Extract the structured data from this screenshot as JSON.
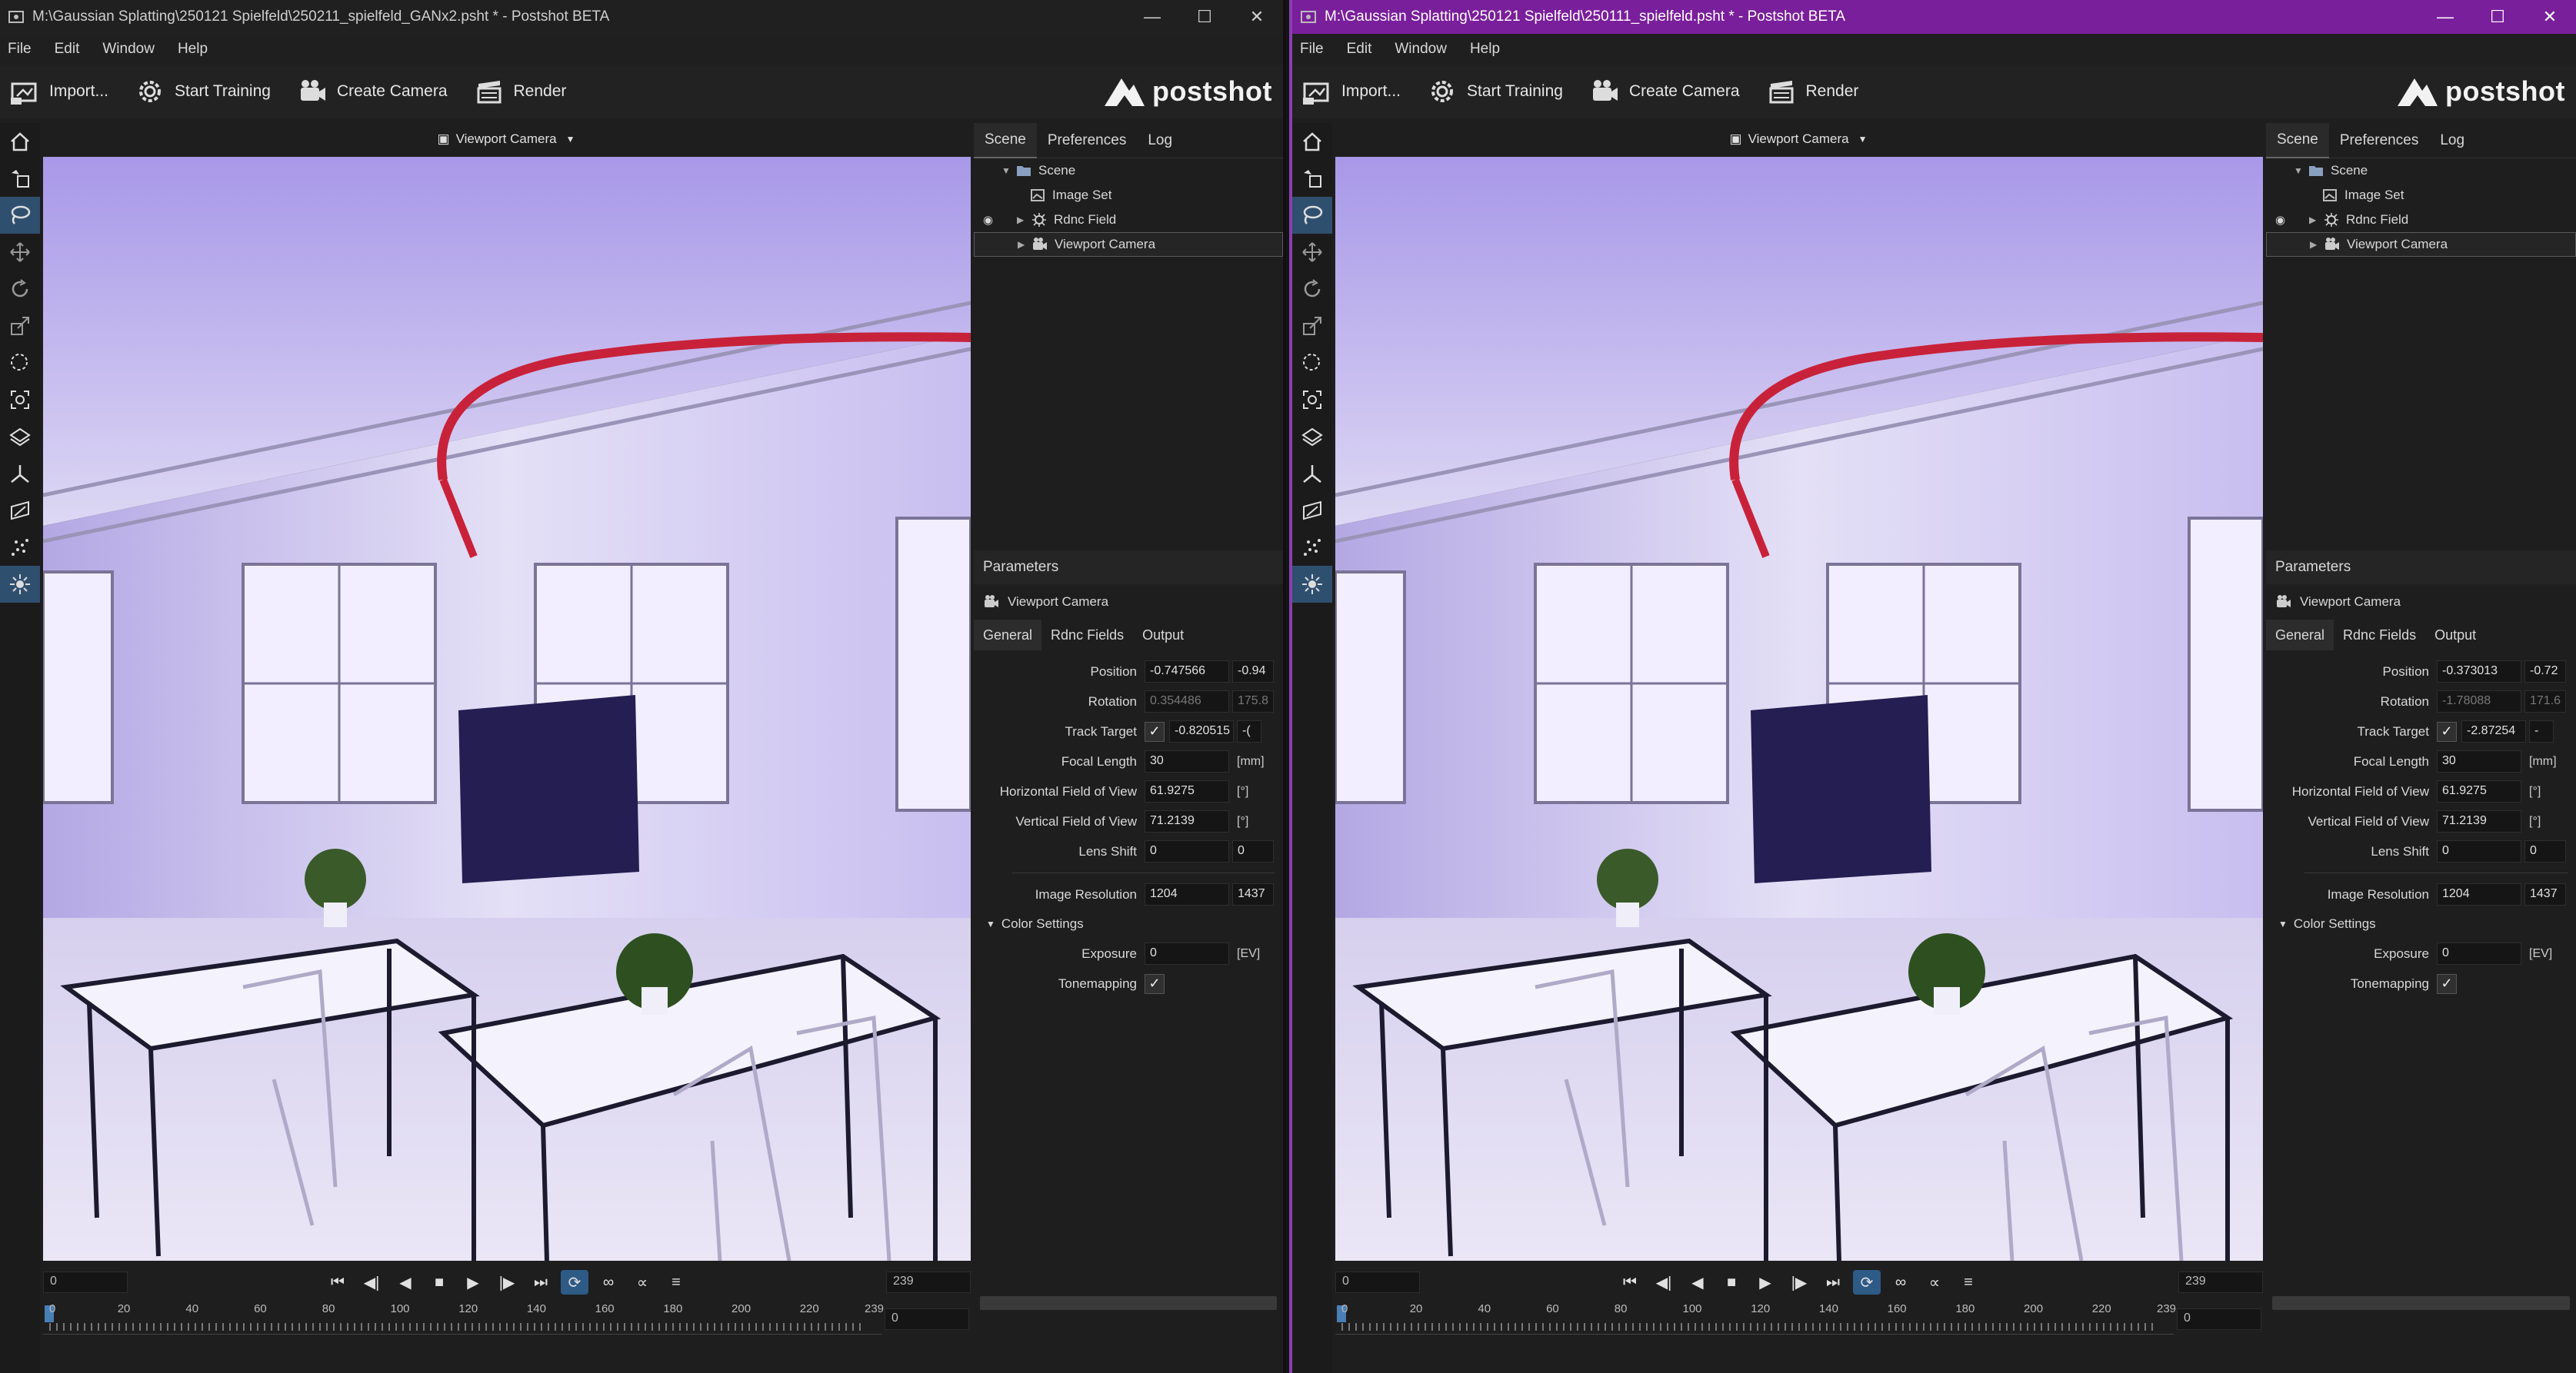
{
  "windows": [
    {
      "title": "M:\\Gaussian Splatting\\250121 Spielfeld\\250211_spielfeld_GANx2.psht * - Postshot BETA",
      "menu": [
        "File",
        "Edit",
        "Window",
        "Help"
      ],
      "toolbar": {
        "import": "Import...",
        "start_training": "Start Training",
        "create_camera": "Create Camera",
        "render": "Render",
        "logo": "postshot"
      },
      "viewport_label": "Viewport Camera",
      "playback": {
        "start_frame": "0",
        "end_frame": "239",
        "current_frame": "0"
      },
      "ruler_ticks": [
        "0",
        "20",
        "40",
        "60",
        "80",
        "100",
        "120",
        "140",
        "160",
        "180",
        "200",
        "220",
        "239"
      ],
      "panel_tabs": [
        "Scene",
        "Preferences",
        "Log"
      ],
      "scene_tree": [
        "Scene",
        "Image Set",
        "Rdnc Field",
        "Viewport Camera"
      ],
      "params": {
        "header": "Parameters",
        "camera": "Viewport Camera",
        "tabs": [
          "General",
          "Rdnc Fields",
          "Output"
        ],
        "position": [
          "-0.747566",
          "-0.94"
        ],
        "rotation": [
          "0.354486",
          "175.8"
        ],
        "track_target": [
          "-0.820515",
          "-("
        ],
        "focal_length": "30",
        "hfov": "61.9275",
        "vfov": "71.2139",
        "lens_shift": [
          "0",
          "0"
        ],
        "image_resolution": [
          "1204",
          "1437"
        ],
        "exposure": "0"
      }
    },
    {
      "title": "M:\\Gaussian Splatting\\250121 Spielfeld\\250111_spielfeld.psht * - Postshot BETA",
      "menu": [
        "File",
        "Edit",
        "Window",
        "Help"
      ],
      "toolbar": {
        "import": "Import...",
        "start_training": "Start Training",
        "create_camera": "Create Camera",
        "render": "Render",
        "logo": "postshot"
      },
      "viewport_label": "Viewport Camera",
      "playback": {
        "start_frame": "0",
        "end_frame": "239",
        "current_frame": "0"
      },
      "ruler_ticks": [
        "0",
        "20",
        "40",
        "60",
        "80",
        "100",
        "120",
        "140",
        "160",
        "180",
        "200",
        "220",
        "239"
      ],
      "panel_tabs": [
        "Scene",
        "Preferences",
        "Log"
      ],
      "scene_tree": [
        "Scene",
        "Image Set",
        "Rdnc Field",
        "Viewport Camera"
      ],
      "params": {
        "header": "Parameters",
        "camera": "Viewport Camera",
        "tabs": [
          "General",
          "Rdnc Fields",
          "Output"
        ],
        "position": [
          "-0.373013",
          "-0.72"
        ],
        "rotation": [
          "-1.78088",
          "171.6"
        ],
        "track_target": [
          "-2.87254",
          "-"
        ],
        "focal_length": "30",
        "hfov": "61.9275",
        "vfov": "71.2139",
        "lens_shift": [
          "0",
          "0"
        ],
        "image_resolution": [
          "1204",
          "1437"
        ],
        "exposure": "0"
      }
    }
  ],
  "labels": {
    "position": "Position",
    "rotation": "Rotation",
    "track_target": "Track Target",
    "focal_length": "Focal Length",
    "hfov": "Horizontal Field of View",
    "vfov": "Vertical Field of View",
    "lens_shift": "Lens Shift",
    "image_resolution": "Image Resolution",
    "color_settings": "Color Settings",
    "exposure": "Exposure",
    "tonemapping": "Tonemapping",
    "unit_mm": "[mm]",
    "unit_deg": "[°]",
    "unit_ev": "[EV]"
  },
  "window_controls": [
    "minimize",
    "maximize",
    "close"
  ],
  "tool_icons": [
    "home-icon",
    "add-object-icon",
    "lasso-icon",
    "move-icon",
    "rotate-icon",
    "scale-icon",
    "select-circle-icon",
    "focus-icon",
    "layers-icon",
    "axis-icon",
    "camera-path-icon",
    "points-icon",
    "light-icon"
  ],
  "colors": {
    "accent_purple": "#7a1f9c",
    "active_tool": "#2f4f6f",
    "play_active": "#2e5a86"
  }
}
